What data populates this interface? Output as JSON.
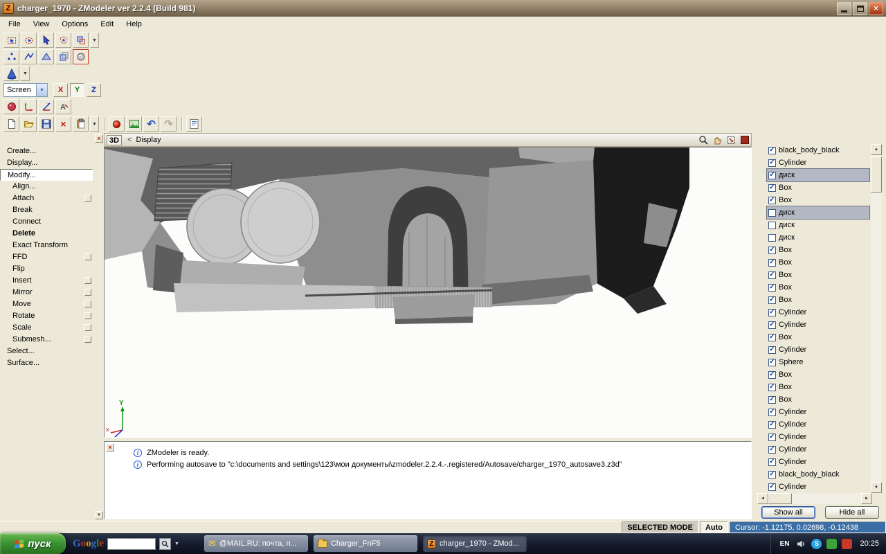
{
  "window": {
    "title": "charger_1970 - ZModeler ver 2.2.4 (Build 981)",
    "menus": [
      "File",
      "View",
      "Options",
      "Edit",
      "Help"
    ]
  },
  "icons": {
    "dropdown": "▼",
    "scroll_up": "▲",
    "scroll_down": "▼",
    "scroll_left": "◄",
    "scroll_right": "►",
    "check": "✓",
    "close": "×",
    "delete": "×",
    "undo": "↶",
    "redo": "↷",
    "info": "i",
    "mail": "✉",
    "zmodeler": "Z",
    "skype": "S"
  },
  "toolbar": {
    "view_combo": "Screen",
    "axes": [
      "X",
      "Y",
      "Z"
    ]
  },
  "left_panel": {
    "items": [
      {
        "label": "Create...",
        "indent": false
      },
      {
        "label": "Display...",
        "indent": false
      },
      {
        "label": "Modify...",
        "indent": false,
        "boxed": true
      },
      {
        "label": "Align...",
        "indent": true
      },
      {
        "label": "Attach",
        "indent": true,
        "checkbox": true
      },
      {
        "label": "Break",
        "indent": true
      },
      {
        "label": "Connect",
        "indent": true
      },
      {
        "label": "Delete",
        "indent": true,
        "bold": true
      },
      {
        "label": "Exact Transform",
        "indent": true
      },
      {
        "label": "FFD",
        "indent": true,
        "checkbox": true
      },
      {
        "label": "Flip",
        "indent": true
      },
      {
        "label": "Insert",
        "indent": true,
        "checkbox": true
      },
      {
        "label": "Mirror",
        "indent": true,
        "checkbox": true
      },
      {
        "label": "Move",
        "indent": true,
        "checkbox": true
      },
      {
        "label": "Rotate",
        "indent": true,
        "checkbox": true
      },
      {
        "label": "Scale",
        "indent": true,
        "checkbox": true
      },
      {
        "label": "Submesh...",
        "indent": true,
        "checkbox": true
      },
      {
        "label": "Select...",
        "indent": false
      },
      {
        "label": "Surface...",
        "indent": false
      }
    ]
  },
  "viewport": {
    "mode_label": "3D",
    "nav_prev": "<",
    "view_label": "Display"
  },
  "scene_list": {
    "items": [
      {
        "label": "black_body_black",
        "checked": true,
        "selected": false
      },
      {
        "label": "Cylinder",
        "checked": true,
        "selected": false
      },
      {
        "label": "диск",
        "checked": true,
        "selected": true
      },
      {
        "label": "Box",
        "checked": true,
        "selected": false
      },
      {
        "label": "Box",
        "checked": true,
        "selected": false
      },
      {
        "label": "диск",
        "checked": false,
        "selected": true
      },
      {
        "label": "диск",
        "checked": false,
        "selected": false
      },
      {
        "label": "диск",
        "checked": false,
        "selected": false
      },
      {
        "label": "Box",
        "checked": true,
        "selected": false
      },
      {
        "label": "Box",
        "checked": true,
        "selected": false
      },
      {
        "label": "Box",
        "checked": true,
        "selected": false
      },
      {
        "label": "Box",
        "checked": true,
        "selected": false
      },
      {
        "label": "Box",
        "checked": true,
        "selected": false
      },
      {
        "label": "Cylinder",
        "checked": true,
        "selected": false
      },
      {
        "label": "Cylinder",
        "checked": true,
        "selected": false
      },
      {
        "label": "Box",
        "checked": true,
        "selected": false
      },
      {
        "label": "Cylinder",
        "checked": true,
        "selected": false
      },
      {
        "label": "Sphere",
        "checked": true,
        "selected": false
      },
      {
        "label": "Box",
        "checked": true,
        "selected": false
      },
      {
        "label": "Box",
        "checked": true,
        "selected": false
      },
      {
        "label": "Box",
        "checked": true,
        "selected": false
      },
      {
        "label": "Cylinder",
        "checked": true,
        "selected": false
      },
      {
        "label": "Cylinder",
        "checked": true,
        "selected": false
      },
      {
        "label": "Cylinder",
        "checked": true,
        "selected": false
      },
      {
        "label": "Cylinder",
        "checked": true,
        "selected": false
      },
      {
        "label": "Cylinder",
        "checked": true,
        "selected": false
      },
      {
        "label": "black_body_black",
        "checked": true,
        "selected": false
      },
      {
        "label": "Cylinder",
        "checked": true,
        "selected": false
      }
    ],
    "show_all": "Show all",
    "hide_all": "Hide all"
  },
  "log": {
    "lines": [
      "ZModeler is ready.",
      "Performing autosave to \"c:\\documents and settings\\123\\мои документы\\zmodeler.2.2.4.-.registered/Autosave/charger_1970_autosave3.z3d\""
    ]
  },
  "status_bar": {
    "mode": "SELECTED MODE",
    "auto": "Auto",
    "cursor": "Cursor: -1.12175, 0.02698, -0.12438"
  },
  "taskbar": {
    "start_label": "пуск",
    "google_label": "Google",
    "tasks": [
      {
        "label": "@MAIL.RU: почта, п...",
        "icon": "mail",
        "active": false
      },
      {
        "label": "Charger_FnF5",
        "icon": "folder",
        "active": false
      },
      {
        "label": "charger_1970 - ZMod...",
        "icon": "zmodeler",
        "active": true
      }
    ],
    "tray": {
      "lang": "EN",
      "time": "20:25"
    }
  },
  "colors": {
    "selection_row": "#b2b8c4",
    "statusbar_cursor_bg": "#3a6ea5",
    "titlebar": "#95856c",
    "start_button_green": "#3c9434",
    "zmodeler_orange": "#d9731c"
  }
}
